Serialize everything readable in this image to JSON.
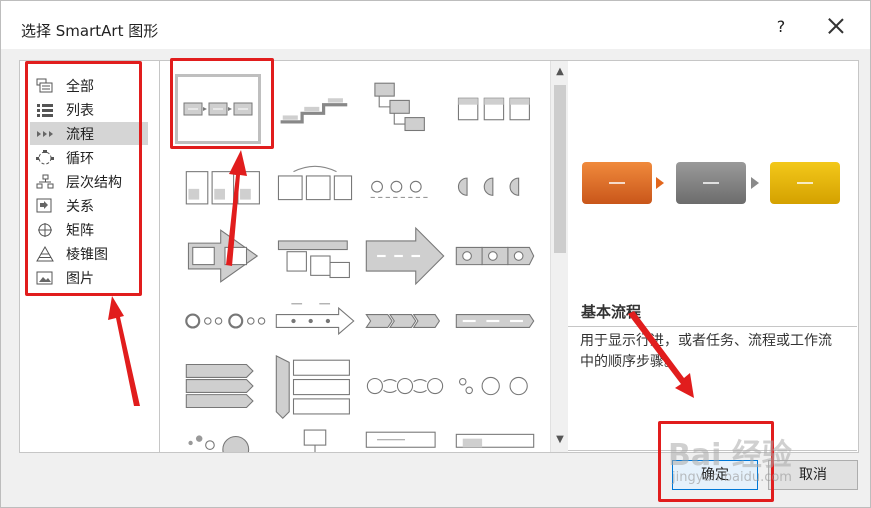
{
  "window": {
    "title": "选择 SmartArt 图形",
    "help_label": "?"
  },
  "categories": [
    {
      "label": "全部",
      "icon": "all-icon",
      "selected": false
    },
    {
      "label": "列表",
      "icon": "list-icon",
      "selected": false
    },
    {
      "label": "流程",
      "icon": "process-icon",
      "selected": true
    },
    {
      "label": "循环",
      "icon": "cycle-icon",
      "selected": false
    },
    {
      "label": "层次结构",
      "icon": "hierarchy-icon",
      "selected": false
    },
    {
      "label": "关系",
      "icon": "relationship-icon",
      "selected": false
    },
    {
      "label": "矩阵",
      "icon": "matrix-icon",
      "selected": false
    },
    {
      "label": "棱锥图",
      "icon": "pyramid-icon",
      "selected": false
    },
    {
      "label": "图片",
      "icon": "picture-icon",
      "selected": false
    }
  ],
  "preview": {
    "name": "基本流程",
    "description": "用于显示行进，或者任务、流程或工作流中的顺序步骤。",
    "box_colors": [
      "#e2661c",
      "#7f7f7f",
      "#e0b200"
    ]
  },
  "buttons": {
    "ok": "确定",
    "cancel": "取消"
  },
  "watermark": {
    "text": "Bai  经验",
    "sub": "jingyan.baidu.com"
  },
  "colors": {
    "annotation": "#e11d1d",
    "selection": "#d5d5d5"
  }
}
